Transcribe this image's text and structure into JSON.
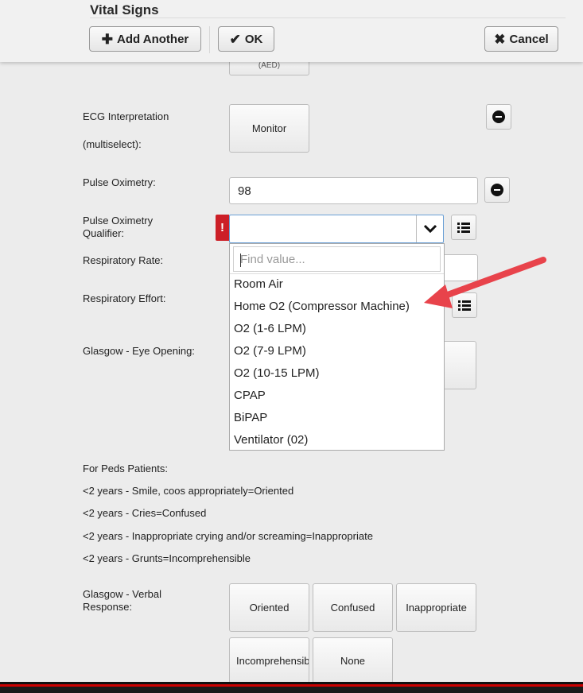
{
  "header": {
    "title": "Vital Signs",
    "add_another_label": "Add Another",
    "ok_label": "OK",
    "cancel_label": "Cancel"
  },
  "form": {
    "aed_label": "(AED)",
    "ecg_label_1": "ECG Interpretation",
    "ecg_label_2": "(multiselect):",
    "ecg_button": "Monitor",
    "pulse_ox_label": "Pulse Oximetry:",
    "pulse_ox_value": "98",
    "pulse_ox_qualifier_label_1": "Pulse Oximetry",
    "pulse_ox_qualifier_label_2": "Qualifier:",
    "required_flag": "!",
    "resp_rate_label": "Respiratory Rate:",
    "resp_effort_label": "Respiratory Effort:",
    "gcs_eye_label": "Glasgow - Eye Opening:",
    "gcs_verbal_label_1": "Glasgow - Verbal",
    "gcs_verbal_label_2": "Response:"
  },
  "dropdown": {
    "search_placeholder": "Find value...",
    "options": [
      "Room Air",
      "Home O2 (Compressor Machine)",
      "O2 (1-6 LPM)",
      "O2 (7-9 LPM)",
      "O2 (10-15 LPM)",
      "CPAP",
      "BiPAP",
      "Ventilator (02)"
    ]
  },
  "peds_notes": [
    "For Peds Patients:",
    "<2 years - Smile, coos appropriately=Oriented",
    "<2 years - Cries=Confused",
    "<2 years - Inappropriate crying and/or screaming=Inappropriate",
    "<2 years - Grunts=Incomprehensible"
  ],
  "verbal_options": [
    "Oriented",
    "Confused",
    "Inappropriate",
    "Incomprehensible",
    "None"
  ],
  "colors": {
    "required_flag": "#cc1f27",
    "annotation_arrow": "#e8434b",
    "focus_border": "#6aa0d6"
  }
}
